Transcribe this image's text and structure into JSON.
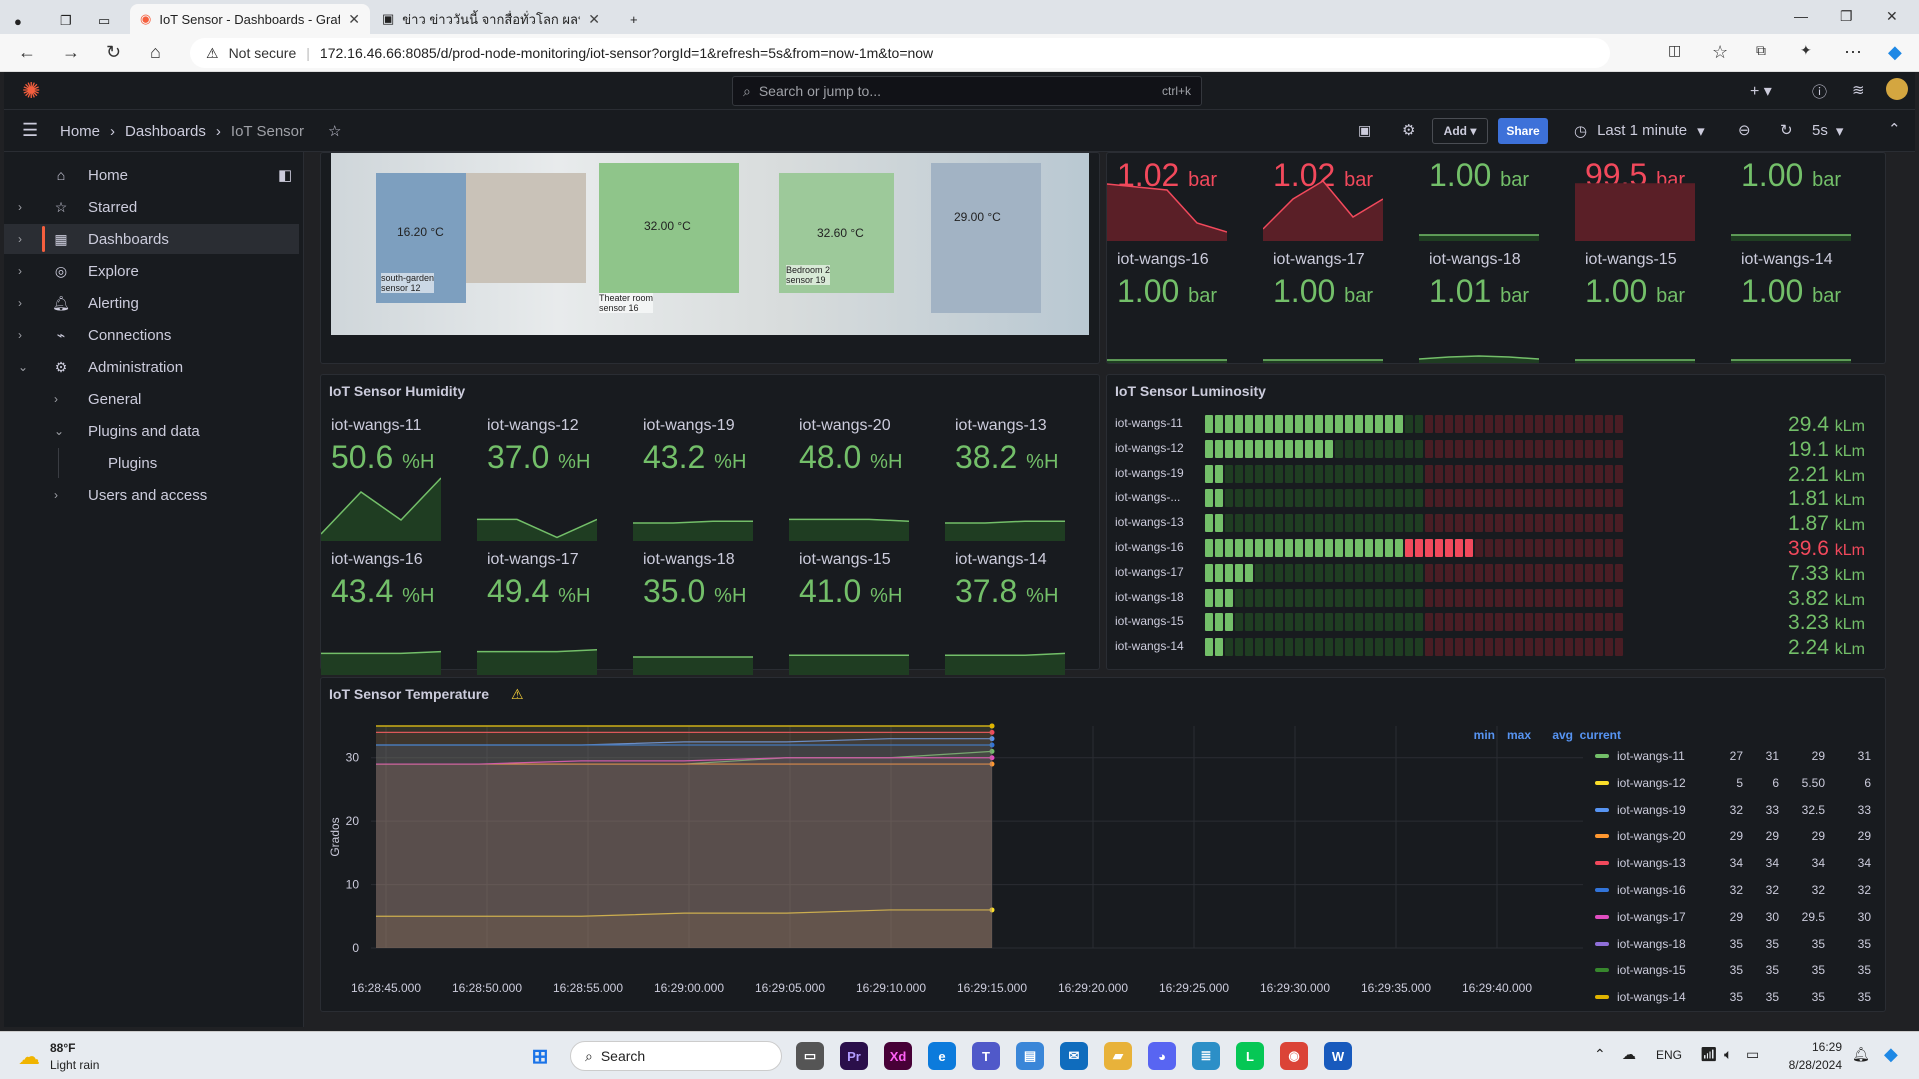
{
  "browser": {
    "tabs": [
      {
        "label": "IoT Sensor - Dashboards - Grafan",
        "active": true
      },
      {
        "label": "ข่าว ข่าววันนี้ จากสื่อทั่วโลก ผลบอลโลก",
        "active": false
      }
    ],
    "security": "Not secure",
    "url": "172.16.46.66:8085/d/prod-node-monitoring/iot-sensor?orgId=1&refresh=5s&from=now-1m&to=now"
  },
  "grafana": {
    "search_placeholder": "Search or jump to...",
    "search_shortcut": "ctrl+k",
    "breadcrumb": [
      "Home",
      "Dashboards",
      "IoT Sensor"
    ],
    "toolbar": {
      "add": "Add",
      "share": "Share",
      "time_range": "Last 1 minute",
      "refresh": "5s"
    }
  },
  "sidebar": {
    "items": [
      {
        "label": "Home",
        "icon": "home-icon"
      },
      {
        "label": "Starred",
        "icon": "star-icon"
      },
      {
        "label": "Dashboards",
        "icon": "grid-icon"
      },
      {
        "label": "Explore",
        "icon": "compass-icon"
      },
      {
        "label": "Alerting",
        "icon": "bell-icon"
      },
      {
        "label": "Connections",
        "icon": "plug-icon"
      },
      {
        "label": "Administration",
        "icon": "gear-icon"
      },
      {
        "label": "General"
      },
      {
        "label": "Plugins and data"
      },
      {
        "label": "Plugins"
      },
      {
        "label": "Users and access"
      }
    ]
  },
  "floorplan": {
    "temps": [
      "16.20 °C",
      "32.00 °C",
      "32.60 °C",
      "29.00 °C"
    ],
    "labels": [
      "south-garden\nsensor 12",
      "Theater room\nsensor 16",
      "Bedroom 2\nsensor 19"
    ]
  },
  "pressure": {
    "top_values": [
      "1.02",
      "1.02",
      "1.00",
      "99.5",
      "1.00"
    ],
    "unit": "bar",
    "stats": [
      {
        "name": "iot-wangs-16",
        "value": "1.00"
      },
      {
        "name": "iot-wangs-17",
        "value": "1.00"
      },
      {
        "name": "iot-wangs-18",
        "value": "1.01"
      },
      {
        "name": "iot-wangs-15",
        "value": "1.00"
      },
      {
        "name": "iot-wangs-14",
        "value": "1.00"
      }
    ]
  },
  "humidity": {
    "title": "IoT Sensor Humidity",
    "unit": "%H",
    "stats": [
      {
        "name": "iot-wangs-11",
        "value": "50.6"
      },
      {
        "name": "iot-wangs-12",
        "value": "37.0"
      },
      {
        "name": "iot-wangs-19",
        "value": "43.2"
      },
      {
        "name": "iot-wangs-20",
        "value": "48.0"
      },
      {
        "name": "iot-wangs-13",
        "value": "38.2"
      },
      {
        "name": "iot-wangs-16",
        "value": "43.4"
      },
      {
        "name": "iot-wangs-17",
        "value": "49.4"
      },
      {
        "name": "iot-wangs-18",
        "value": "35.0"
      },
      {
        "name": "iot-wangs-15",
        "value": "41.0"
      },
      {
        "name": "iot-wangs-14",
        "value": "37.8"
      }
    ]
  },
  "luminosity": {
    "title": "IoT Sensor Luminosity",
    "unit": "kLm",
    "rows": [
      {
        "name": "iot-wangs-11",
        "value": "29.4",
        "lit": 20,
        "color": "#73bf69"
      },
      {
        "name": "iot-wangs-12",
        "value": "19.1",
        "lit": 13,
        "color": "#73bf69"
      },
      {
        "name": "iot-wangs-19",
        "value": "2.21",
        "lit": 2,
        "color": "#73bf69"
      },
      {
        "name": "iot-wangs-...",
        "value": "1.81",
        "lit": 2,
        "color": "#73bf69"
      },
      {
        "name": "iot-wangs-13",
        "value": "1.87",
        "lit": 2,
        "color": "#73bf69"
      },
      {
        "name": "iot-wangs-16",
        "value": "39.6",
        "lit": 27,
        "color": "#f2495c"
      },
      {
        "name": "iot-wangs-17",
        "value": "7.33",
        "lit": 5,
        "color": "#73bf69"
      },
      {
        "name": "iot-wangs-18",
        "value": "3.82",
        "lit": 3,
        "color": "#73bf69"
      },
      {
        "name": "iot-wangs-15",
        "value": "3.23",
        "lit": 3,
        "color": "#73bf69"
      },
      {
        "name": "iot-wangs-14",
        "value": "2.24",
        "lit": 2,
        "color": "#73bf69"
      }
    ]
  },
  "temperature": {
    "title": "IoT Sensor Temperature",
    "legend_headers": [
      "min",
      "max",
      "avg",
      "current"
    ],
    "legend": [
      {
        "name": "iot-wangs-11",
        "min": "27",
        "max": "31",
        "avg": "29",
        "current": "31",
        "color": "#73bf69"
      },
      {
        "name": "iot-wangs-12",
        "min": "5",
        "max": "6",
        "avg": "5.50",
        "current": "6",
        "color": "#fade2a"
      },
      {
        "name": "iot-wangs-19",
        "min": "32",
        "max": "33",
        "avg": "32.5",
        "current": "33",
        "color": "#5794f2"
      },
      {
        "name": "iot-wangs-20",
        "min": "29",
        "max": "29",
        "avg": "29",
        "current": "29",
        "color": "#ff9830"
      },
      {
        "name": "iot-wangs-13",
        "min": "34",
        "max": "34",
        "avg": "34",
        "current": "34",
        "color": "#f2495c"
      },
      {
        "name": "iot-wangs-16",
        "min": "32",
        "max": "32",
        "avg": "32",
        "current": "32",
        "color": "#3274d9"
      },
      {
        "name": "iot-wangs-17",
        "min": "29",
        "max": "30",
        "avg": "29.5",
        "current": "30",
        "color": "#e04ec0"
      },
      {
        "name": "iot-wangs-18",
        "min": "35",
        "max": "35",
        "avg": "35",
        "current": "35",
        "color": "#8f6fd8"
      },
      {
        "name": "iot-wangs-15",
        "min": "35",
        "max": "35",
        "avg": "35",
        "current": "35",
        "color": "#37872d"
      },
      {
        "name": "iot-wangs-14",
        "min": "35",
        "max": "35",
        "avg": "35",
        "current": "35",
        "color": "#e0b400"
      }
    ]
  },
  "chart_data": {
    "type": "line",
    "title": "IoT Sensor Temperature",
    "ylabel": "Grados",
    "ylim": [
      0,
      35
    ],
    "yticks": [
      0,
      10,
      20,
      30
    ],
    "x": [
      "16:28:45.000",
      "16:28:50.000",
      "16:28:55.000",
      "16:29:00.000",
      "16:29:05.000",
      "16:29:10.000",
      "16:29:15.000",
      "16:29:20.000",
      "16:29:25.000",
      "16:29:30.000",
      "16:29:35.000",
      "16:29:40.000"
    ],
    "series": [
      {
        "name": "iot-wangs-11",
        "values": [
          29,
          29,
          29,
          29,
          30,
          30,
          31
        ]
      },
      {
        "name": "iot-wangs-12",
        "values": [
          5,
          5,
          5,
          5.5,
          5.5,
          6,
          6
        ]
      },
      {
        "name": "iot-wangs-19",
        "values": [
          32,
          32,
          32,
          32.5,
          32.5,
          33,
          33
        ]
      },
      {
        "name": "iot-wangs-20",
        "values": [
          29,
          29,
          29,
          29,
          29,
          29,
          29
        ]
      },
      {
        "name": "iot-wangs-13",
        "values": [
          34,
          34,
          34,
          34,
          34,
          34,
          34
        ]
      },
      {
        "name": "iot-wangs-16",
        "values": [
          32,
          32,
          32,
          32,
          32,
          32,
          32
        ]
      },
      {
        "name": "iot-wangs-17",
        "values": [
          29,
          29,
          29.5,
          29.5,
          30,
          30,
          30
        ]
      },
      {
        "name": "iot-wangs-18",
        "values": [
          35,
          35,
          35,
          35,
          35,
          35,
          35
        ]
      },
      {
        "name": "iot-wangs-15",
        "values": [
          35,
          35,
          35,
          35,
          35,
          35,
          35
        ]
      },
      {
        "name": "iot-wangs-14",
        "values": [
          35,
          35,
          35,
          35,
          35,
          35,
          35
        ]
      }
    ]
  },
  "taskbar": {
    "weather_temp": "88°F",
    "weather_desc": "Light rain",
    "search": "Search",
    "lang": "ENG",
    "time": "16:29",
    "date": "8/28/2024"
  }
}
